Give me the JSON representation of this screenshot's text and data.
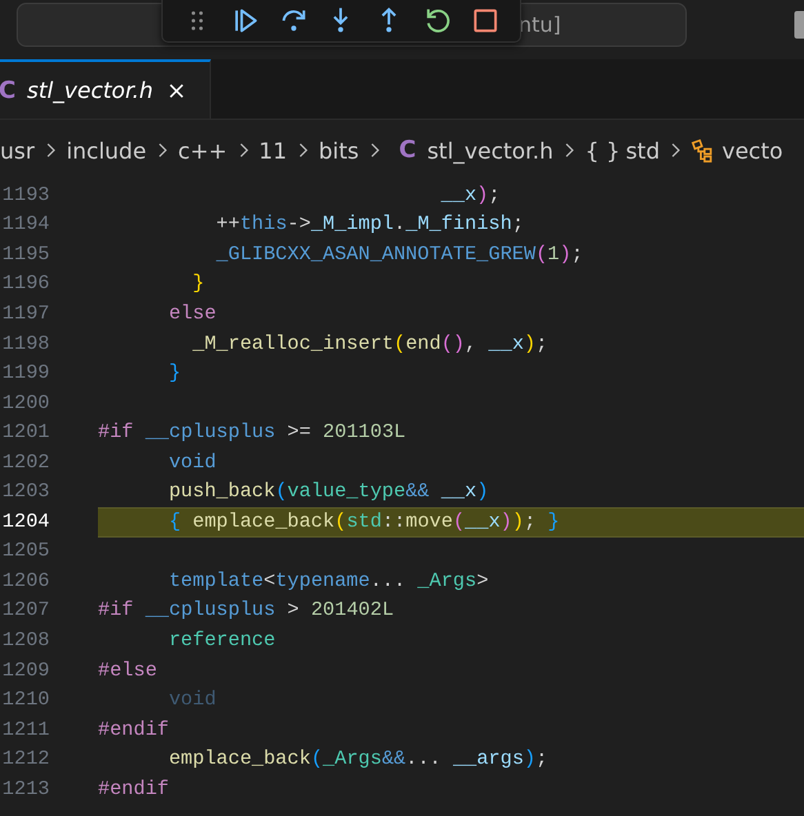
{
  "title_bar": {
    "search_text": "ntu]"
  },
  "debug_toolbar": {
    "buttons": [
      {
        "kind": "grip"
      },
      {
        "kind": "continue"
      },
      {
        "kind": "step_over"
      },
      {
        "kind": "step_into"
      },
      {
        "kind": "step_out"
      },
      {
        "kind": "restart"
      },
      {
        "kind": "stop"
      }
    ]
  },
  "tabs": [
    {
      "icon": "C",
      "label": "stl_vector.h",
      "selected": true,
      "preview": true
    }
  ],
  "breadcrumb": [
    {
      "text": "usr",
      "kind": "folder"
    },
    {
      "text": "include",
      "kind": "folder"
    },
    {
      "text": "c++",
      "kind": "folder"
    },
    {
      "text": "11",
      "kind": "folder"
    },
    {
      "text": "bits",
      "kind": "folder"
    },
    {
      "icon": "C",
      "text": "stl_vector.h",
      "kind": "file"
    },
    {
      "icon": "{ }",
      "text": "std",
      "kind": "namespace"
    },
    {
      "text": "vecto",
      "kind": "class"
    }
  ],
  "code_lines": [
    {
      "number": "1193",
      "current": false,
      "tokens": [
        {
          "text": "                             __x",
          "kind": "var"
        },
        {
          "text": ")",
          "kind": "bracket2"
        },
        {
          "text": ";",
          "kind": "op"
        }
      ]
    },
    {
      "number": "1194",
      "current": false,
      "tokens": [
        {
          "text": "          ++",
          "kind": "op"
        },
        {
          "text": "this",
          "kind": "keyword"
        },
        {
          "text": "->",
          "kind": "op"
        },
        {
          "text": "_M_impl",
          "kind": "var"
        },
        {
          "text": ".",
          "kind": "op"
        },
        {
          "text": "_M_finish",
          "kind": "var"
        },
        {
          "text": ";",
          "kind": "op"
        }
      ]
    },
    {
      "number": "1195",
      "current": false,
      "tokens": [
        {
          "text": "          _GLIBCXX_ASAN_ANNOTATE_GREW",
          "kind": "keyword"
        },
        {
          "text": "(",
          "kind": "bracket2"
        },
        {
          "text": "1",
          "kind": "number"
        },
        {
          "text": ")",
          "kind": "bracket2"
        },
        {
          "text": ";",
          "kind": "op"
        }
      ]
    },
    {
      "number": "1196",
      "current": false,
      "tokens": [
        {
          "text": "        }",
          "kind": "bracket1"
        }
      ]
    },
    {
      "number": "1197",
      "current": false,
      "tokens": [
        {
          "text": "      else",
          "kind": "control"
        }
      ]
    },
    {
      "number": "1198",
      "current": false,
      "tokens": [
        {
          "text": "        _M_realloc_insert",
          "kind": "func"
        },
        {
          "text": "(",
          "kind": "bracket1"
        },
        {
          "text": "end",
          "kind": "func"
        },
        {
          "text": "()",
          "kind": "bracket2"
        },
        {
          "text": ", ",
          "kind": "op"
        },
        {
          "text": "__x",
          "kind": "var"
        },
        {
          "text": ")",
          "kind": "bracket1"
        },
        {
          "text": ";",
          "kind": "op"
        }
      ]
    },
    {
      "number": "1199",
      "current": false,
      "tokens": [
        {
          "text": "      }",
          "kind": "bracket3"
        }
      ]
    },
    {
      "number": "1200",
      "current": false
    },
    {
      "number": "1201",
      "current": false,
      "tokens": [
        {
          "text": "#if",
          "kind": "control"
        },
        {
          "text": " __cplusplus",
          "kind": "keyword"
        },
        {
          "text": " >= ",
          "kind": "op"
        },
        {
          "text": "201103L",
          "kind": "number"
        }
      ]
    },
    {
      "number": "1202",
      "current": false,
      "tokens": [
        {
          "text": "      void",
          "kind": "keyword"
        }
      ]
    },
    {
      "number": "1203",
      "current": false,
      "tokens": [
        {
          "text": "      push_back",
          "kind": "func"
        },
        {
          "text": "(",
          "kind": "bracket3"
        },
        {
          "text": "value_type",
          "kind": "type"
        },
        {
          "text": "&&",
          "kind": "keyword"
        },
        {
          "text": " __x",
          "kind": "var"
        },
        {
          "text": ")",
          "kind": "bracket3"
        }
      ]
    },
    {
      "number": "1204",
      "current": true,
      "tokens": [
        {
          "text": "      {",
          "kind": "bracket3"
        },
        {
          "text": " emplace_back",
          "kind": "func"
        },
        {
          "text": "(",
          "kind": "bracket1"
        },
        {
          "text": "std",
          "kind": "type"
        },
        {
          "text": "::",
          "kind": "op"
        },
        {
          "text": "move",
          "kind": "func"
        },
        {
          "text": "(",
          "kind": "bracket2"
        },
        {
          "text": "__x",
          "kind": "var"
        },
        {
          "text": ")",
          "kind": "bracket2"
        },
        {
          "text": ")",
          "kind": "bracket1"
        },
        {
          "text": "; ",
          "kind": "op"
        },
        {
          "text": "}",
          "kind": "bracket3"
        }
      ]
    },
    {
      "number": "1205",
      "current": false
    },
    {
      "number": "1206",
      "current": false,
      "tokens": [
        {
          "text": "      template",
          "kind": "keyword"
        },
        {
          "text": "<",
          "kind": "op"
        },
        {
          "text": "typename",
          "kind": "keyword"
        },
        {
          "text": "... ",
          "kind": "op"
        },
        {
          "text": "_Args",
          "kind": "type"
        },
        {
          "text": ">",
          "kind": "op"
        }
      ]
    },
    {
      "number": "1207",
      "current": false,
      "tokens": [
        {
          "text": "#if",
          "kind": "control"
        },
        {
          "text": " __cplusplus",
          "kind": "keyword"
        },
        {
          "text": " > ",
          "kind": "op"
        },
        {
          "text": "201402L",
          "kind": "number"
        }
      ]
    },
    {
      "number": "1208",
      "current": false,
      "tokens": [
        {
          "text": "      reference",
          "kind": "type"
        }
      ]
    },
    {
      "number": "1209",
      "current": false,
      "tokens": [
        {
          "text": "#else",
          "kind": "control"
        }
      ]
    },
    {
      "number": "1210",
      "current": false,
      "tokens": [
        {
          "text": "      void",
          "kind": "inactive"
        }
      ]
    },
    {
      "number": "1211",
      "current": false,
      "tokens": [
        {
          "text": "#endif",
          "kind": "control"
        }
      ]
    },
    {
      "number": "1212",
      "current": false,
      "tokens": [
        {
          "text": "      emplace_back",
          "kind": "func"
        },
        {
          "text": "(",
          "kind": "bracket3"
        },
        {
          "text": "_Args",
          "kind": "type"
        },
        {
          "text": "&&",
          "kind": "keyword"
        },
        {
          "text": "... ",
          "kind": "op"
        },
        {
          "text": "__args",
          "kind": "var"
        },
        {
          "text": ")",
          "kind": "bracket3"
        },
        {
          "text": ";",
          "kind": "op"
        }
      ]
    },
    {
      "number": "1213",
      "current": false,
      "tokens": [
        {
          "text": "#endif",
          "kind": "control"
        }
      ]
    }
  ]
}
